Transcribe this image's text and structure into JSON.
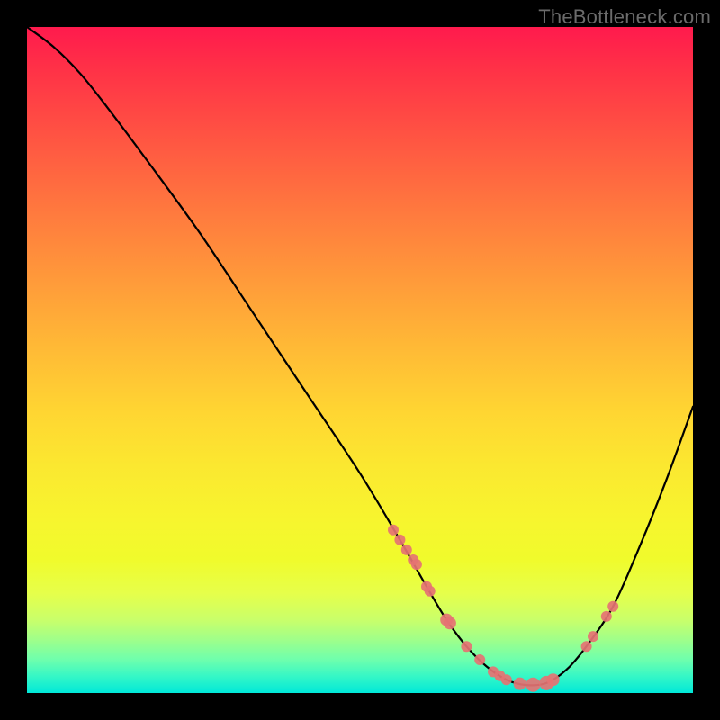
{
  "watermark": "TheBottleneck.com",
  "colors": {
    "background": "#000000",
    "gradient_top": "#ff1a4d",
    "gradient_bottom": "#00e8d8",
    "curve": "#000000",
    "marker": "#e57373"
  },
  "chart_data": {
    "type": "line",
    "title": "",
    "xlabel": "",
    "ylabel": "",
    "xlim": [
      0,
      100
    ],
    "ylim": [
      0,
      100
    ],
    "series": [
      {
        "name": "bottleneck-curve",
        "x": [
          0,
          4,
          8,
          12,
          18,
          26,
          34,
          42,
          50,
          56,
          60,
          63,
          66,
          69,
          72,
          75,
          78,
          81,
          84,
          88,
          92,
          96,
          100
        ],
        "y": [
          100,
          97,
          93,
          88,
          80,
          69,
          57,
          45,
          33,
          23,
          16,
          11,
          7,
          4,
          2,
          1.2,
          1.5,
          3.5,
          7,
          13,
          22,
          32,
          43
        ]
      }
    ],
    "markers": {
      "name": "highlight-points",
      "x": [
        55,
        56,
        57,
        58,
        58.5,
        60,
        60.5,
        63,
        63.5,
        66,
        68,
        70,
        71,
        72,
        74,
        76,
        78,
        79,
        84,
        85,
        87,
        88
      ],
      "y": [
        24.5,
        23,
        21.5,
        20,
        19.3,
        16,
        15.3,
        11,
        10.5,
        7,
        5,
        3.2,
        2.6,
        2,
        1.4,
        1.25,
        1.5,
        2,
        7,
        8.5,
        11.5,
        13
      ],
      "r": [
        6,
        6,
        6,
        6,
        6,
        6,
        6,
        7,
        7,
        6,
        6,
        6,
        6,
        6,
        7,
        8,
        8,
        7,
        6,
        6,
        6,
        6
      ]
    }
  }
}
